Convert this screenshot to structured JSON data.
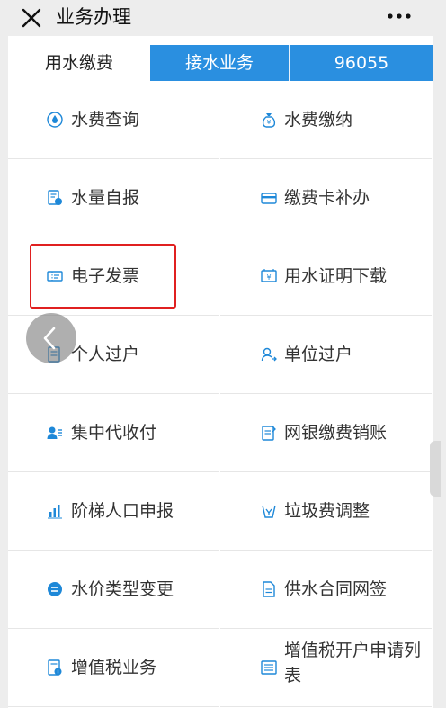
{
  "header": {
    "title": "业务办理"
  },
  "tabs": [
    {
      "label": "用水缴费"
    },
    {
      "label": "接水业务"
    },
    {
      "label": "96055"
    }
  ],
  "items": [
    {
      "label": "水费查询",
      "icon": "water-drop-icon"
    },
    {
      "label": "水费缴纳",
      "icon": "money-bag-icon"
    },
    {
      "label": "水量自报",
      "icon": "report-doc-icon"
    },
    {
      "label": "缴费卡补办",
      "icon": "card-icon"
    },
    {
      "label": "电子发票",
      "icon": "ticket-icon"
    },
    {
      "label": "用水证明下载",
      "icon": "certificate-icon"
    },
    {
      "label": "个人过户",
      "icon": "transfer-doc-icon"
    },
    {
      "label": "单位过户",
      "icon": "person-transfer-icon"
    },
    {
      "label": "集中代收付",
      "icon": "group-payment-icon"
    },
    {
      "label": "网银缴费销账",
      "icon": "bank-doc-icon"
    },
    {
      "label": "阶梯人口申报",
      "icon": "bar-steps-icon"
    },
    {
      "label": "垃圾费调整",
      "icon": "trash-bin-icon"
    },
    {
      "label": "水价类型变更",
      "icon": "switch-circle-icon"
    },
    {
      "label": "供水合同网签",
      "icon": "contract-doc-icon"
    },
    {
      "label": "增值税业务",
      "icon": "tax-doc-icon"
    },
    {
      "label": "增值税开户申请列表",
      "icon": "list-icon"
    }
  ],
  "colors": {
    "accent": "#2a8fe0",
    "icon": "#1e88d8",
    "highlight": "#e02020"
  }
}
